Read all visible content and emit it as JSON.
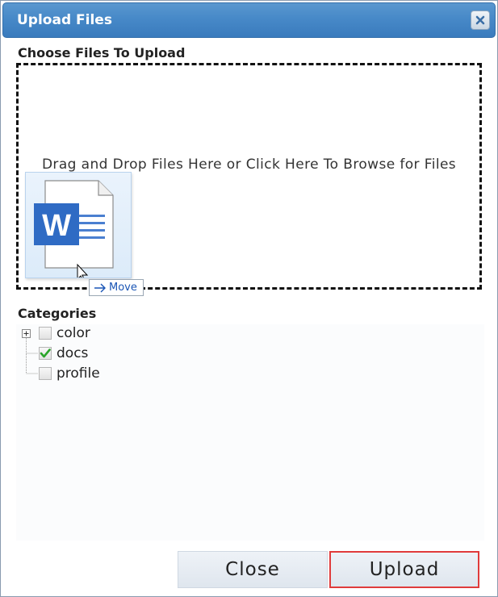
{
  "dialog": {
    "title": "Upload Files",
    "close_icon": "close-x-icon",
    "accent": "#4789c8"
  },
  "upload": {
    "section_label": "Choose Files To Upload",
    "dropzone_text": "Drag and Drop Files Here or Click Here To Browse for Files",
    "drag_icon": "word-document-icon",
    "drag_tooltip": "Move"
  },
  "categories": {
    "section_label": "Categories",
    "items": [
      {
        "label": "color",
        "checked": false,
        "expandable": true
      },
      {
        "label": "docs",
        "checked": true,
        "expandable": false
      },
      {
        "label": "profile",
        "checked": false,
        "expandable": false
      }
    ]
  },
  "buttons": {
    "close_label": "Close",
    "upload_label": "Upload",
    "highlight_color": "#e03b3b"
  }
}
